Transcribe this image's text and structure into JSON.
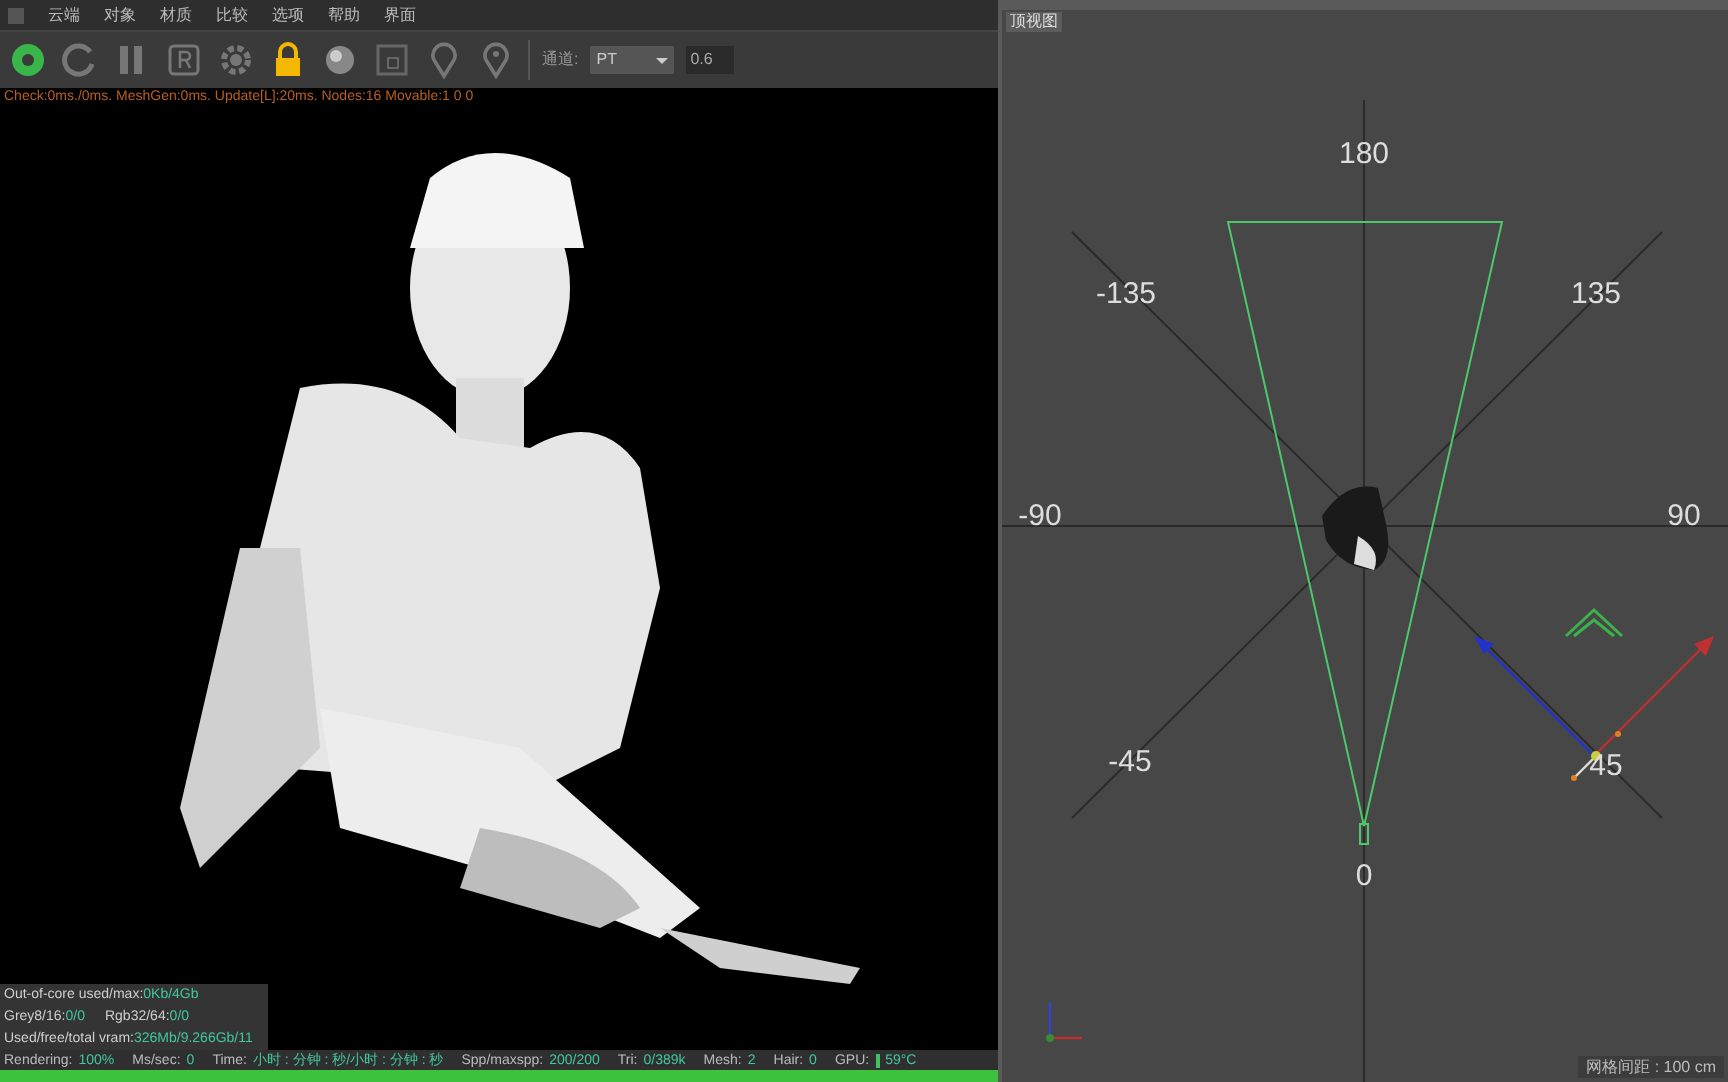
{
  "menu": [
    "云端",
    "对象",
    "材质",
    "比较",
    "选项",
    "帮助",
    "界面"
  ],
  "toolbar": {
    "channel_label": "通道:",
    "channel_value": "PT",
    "spinner_value": "0.6"
  },
  "render_view": {
    "info_line": "Check:0ms./0ms. MeshGen:0ms. Update[L]:20ms. Nodes:16 Movable:1  0 0",
    "stats": [
      [
        {
          "label": "Out-of-core used/max:",
          "value": "0Kb/4Gb"
        }
      ],
      [
        {
          "label": "Grey8/16:",
          "value": "0/0"
        },
        {
          "label": "Rgb32/64:",
          "value": "0/0"
        }
      ],
      [
        {
          "label": "Used/free/total vram:",
          "value": "326Mb/9.266Gb/11"
        }
      ]
    ]
  },
  "status_bar": [
    {
      "label": "Rendering:",
      "value": "100%"
    },
    {
      "label": "Ms/sec:",
      "value": "0"
    },
    {
      "label": "Time:",
      "value": "小时 : 分钟 : 秒/小时 : 分钟 : 秒"
    },
    {
      "label": "Spp/maxspp:",
      "value": "200/200"
    },
    {
      "label": "Tri:",
      "value": "0/389k"
    },
    {
      "label": "Mesh:",
      "value": "2"
    },
    {
      "label": "Hair:",
      "value": "0"
    },
    {
      "label": "GPU:",
      "value": "59°C"
    }
  ],
  "progress": {
    "level": 1
  },
  "top_view": {
    "title": "顶视图",
    "axis_labels": [
      "180",
      "-135",
      "135",
      "-90",
      "90",
      "-45",
      "45",
      "0"
    ],
    "grid_spacing": "网格间距 : 100 cm"
  }
}
